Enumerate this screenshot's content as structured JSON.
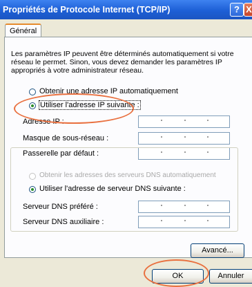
{
  "window": {
    "title": "Propriétés de Protocole Internet (TCP/IP)",
    "help_icon": "?",
    "close_icon": "X"
  },
  "tabs": [
    {
      "label": "Général"
    }
  ],
  "intro_text": "Les paramètres IP peuvent être déterminés automatiquement si votre réseau le permet. Sinon, vous devez demander les paramètres IP appropriés à votre administrateur réseau.",
  "ip": {
    "auto_option": "Obtenir une adresse IP automatiquement",
    "manual_option": "Utiliser l'adresse IP suivante :",
    "selected": "manual",
    "fields": [
      {
        "label": "Adresse IP :",
        "value": ""
      },
      {
        "label": "Masque de sous-réseau :",
        "value": ""
      },
      {
        "label": "Passerelle par défaut :",
        "value": ""
      }
    ]
  },
  "dns": {
    "auto_option": "Obtenir les adresses des serveurs DNS automatiquement",
    "manual_option": "Utiliser l'adresse de serveur DNS suivante :",
    "selected": "manual",
    "fields": [
      {
        "label": "Serveur DNS préféré :",
        "value": ""
      },
      {
        "label": "Serveur DNS auxiliaire :",
        "value": ""
      }
    ]
  },
  "buttons": {
    "advanced": "Avancé...",
    "ok": "OK",
    "cancel": "Annuler"
  },
  "colors": {
    "titlebar": "#1d5fd6",
    "window_bg": "#ece9d8",
    "annotation": "#e9703f",
    "radio_dot": "#2a8d2a"
  }
}
